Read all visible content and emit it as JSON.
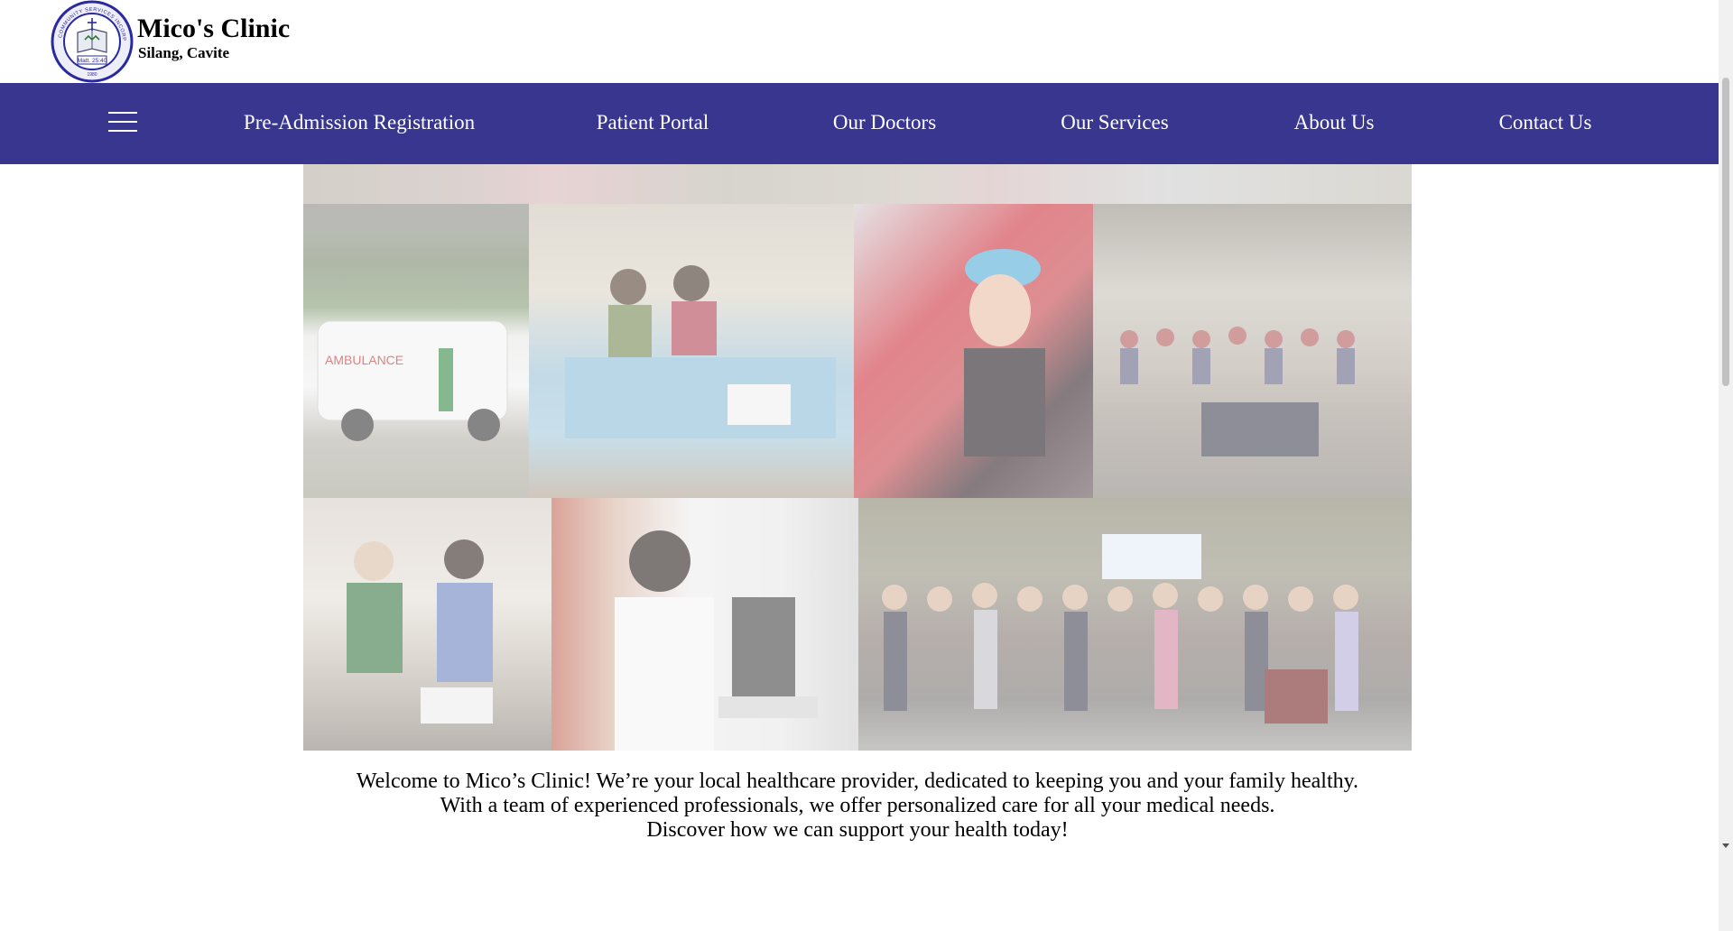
{
  "header": {
    "brand_name": "Mico's Clinic",
    "brand_location": "Silang, Cavite",
    "logo": {
      "ring_text": "MISSION COMMUNITY SERVICES INCORPORATED",
      "verse": "Matt. 25:40",
      "year": "1980",
      "color": "#2a2aa0"
    }
  },
  "nav": {
    "background": "#38368f",
    "menu_icon": "hamburger-menu-icon",
    "items": [
      {
        "label": "Pre-Admission Registration"
      },
      {
        "label": "Patient Portal"
      },
      {
        "label": "Our Doctors"
      },
      {
        "label": "Our Services"
      },
      {
        "label": "About Us"
      },
      {
        "label": "Contact Us"
      }
    ]
  },
  "hero": {
    "photos": [
      "ambulance-photo",
      "registration-desk-photo",
      "nasal-swab-photo",
      "waiting-area-photo",
      "clinic-staff-photo",
      "microscope-lab-photo",
      "community-group-photo"
    ]
  },
  "welcome": {
    "line1": "Welcome to Mico’s Clinic! We’re your local healthcare provider, dedicated to keeping you and your family healthy.",
    "line2": "With a team of experienced professionals, we offer personalized care for all your medical needs.",
    "line3": "Discover how we can support your health today!"
  }
}
